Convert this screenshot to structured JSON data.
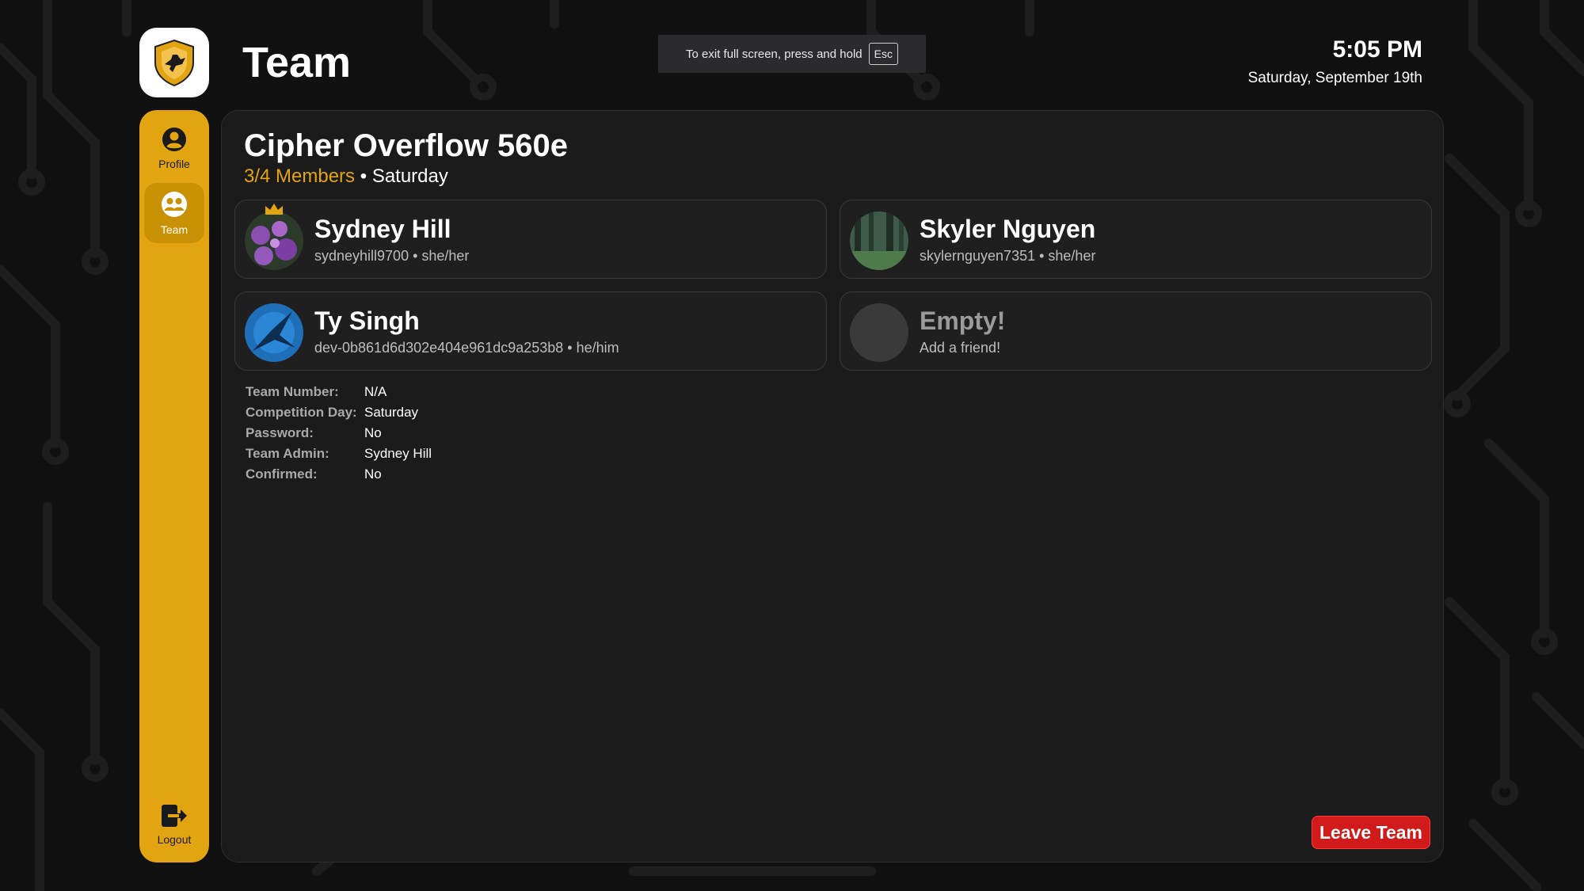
{
  "header": {
    "page_title": "Team",
    "time": "5:05 PM",
    "date": "Saturday, September 19th"
  },
  "fullscreen_toast": {
    "message": "To exit full screen, press and hold",
    "key": "Esc"
  },
  "sidebar": {
    "items": [
      {
        "label": "Profile",
        "icon": "user-circle-icon",
        "active": false
      },
      {
        "label": "Team",
        "icon": "team-icon",
        "active": true
      },
      {
        "label": "Logout",
        "icon": "logout-icon",
        "active": false
      }
    ]
  },
  "team": {
    "name": "Cipher Overflow 560e",
    "members_count": "3/4 Members",
    "separator": "•",
    "day": "Saturday"
  },
  "members": [
    {
      "name": "Sydney Hill",
      "sub": "sydneyhill9700 • she/her",
      "admin": true,
      "avatar": "flowers-avatar"
    },
    {
      "name": "Skyler Nguyen",
      "sub": "skylernguyen7351 • she/her",
      "admin": false,
      "avatar": "forest-avatar"
    },
    {
      "name": "Ty Singh",
      "sub": "dev-0b861d6d302e404e961dc9a253b8 • he/him",
      "admin": false,
      "avatar": "bird-avatar"
    },
    {
      "name": "Empty!",
      "sub": "Add a friend!",
      "admin": false,
      "avatar": "empty-avatar"
    }
  ],
  "details": [
    {
      "label": "Team Number:",
      "value": "N/A"
    },
    {
      "label": "Competition Day:",
      "value": "Saturday"
    },
    {
      "label": "Password:",
      "value": "No"
    },
    {
      "label": "Team Admin:",
      "value": "Sydney Hill"
    },
    {
      "label": "Confirmed:",
      "value": "No"
    }
  ],
  "actions": {
    "leave_label": "Leave Team"
  },
  "colors": {
    "accent": "#e3a411",
    "danger": "#d11a1a",
    "background": "#111111",
    "panel": "#1b1b1b"
  }
}
